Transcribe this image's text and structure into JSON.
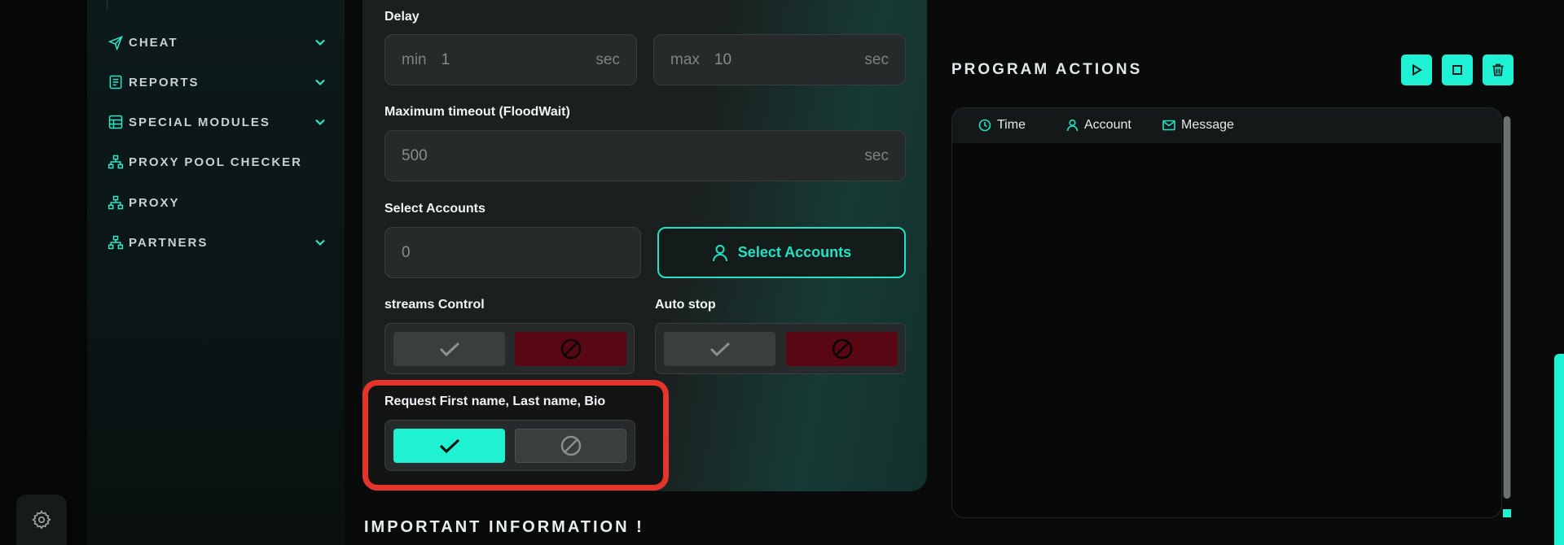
{
  "sidebar": {
    "items": [
      {
        "label": "CHEAT",
        "icon": "paper-plane-icon",
        "has_chevron": true
      },
      {
        "label": "REPORTS",
        "icon": "report-icon",
        "has_chevron": true
      },
      {
        "label": "SPECIAL MODULES",
        "icon": "table-icon",
        "has_chevron": true
      },
      {
        "label": "PROXY POOL CHECKER",
        "icon": "network-icon",
        "has_chevron": false
      },
      {
        "label": "PROXY",
        "icon": "network-icon",
        "has_chevron": false
      },
      {
        "label": "PARTNERS",
        "icon": "network-icon",
        "has_chevron": true
      }
    ]
  },
  "form": {
    "delay": {
      "label": "Delay",
      "min_prefix": "min",
      "min_value": "1",
      "max_prefix": "max",
      "max_value": "10",
      "unit": "sec"
    },
    "timeout": {
      "label": "Maximum timeout (FloodWait)",
      "placeholder": "500",
      "unit": "sec"
    },
    "accounts": {
      "label": "Select Accounts",
      "value": "0",
      "button_label": "Select Accounts"
    },
    "streams_control": {
      "label": "streams Control",
      "state": "disabled"
    },
    "auto_stop": {
      "label": "Auto stop",
      "state": "disabled"
    },
    "request_names": {
      "label": "Request First name, Last name, Bio",
      "state": "enabled"
    }
  },
  "info": {
    "title": "IMPORTANT INFORMATION !"
  },
  "program_actions": {
    "title": "PROGRAM ACTIONS",
    "columns": [
      "Time",
      "Account",
      "Message"
    ]
  },
  "colors": {
    "accent": "#1ff2d4",
    "danger": "#5a0714",
    "highlight": "#e4342b"
  }
}
